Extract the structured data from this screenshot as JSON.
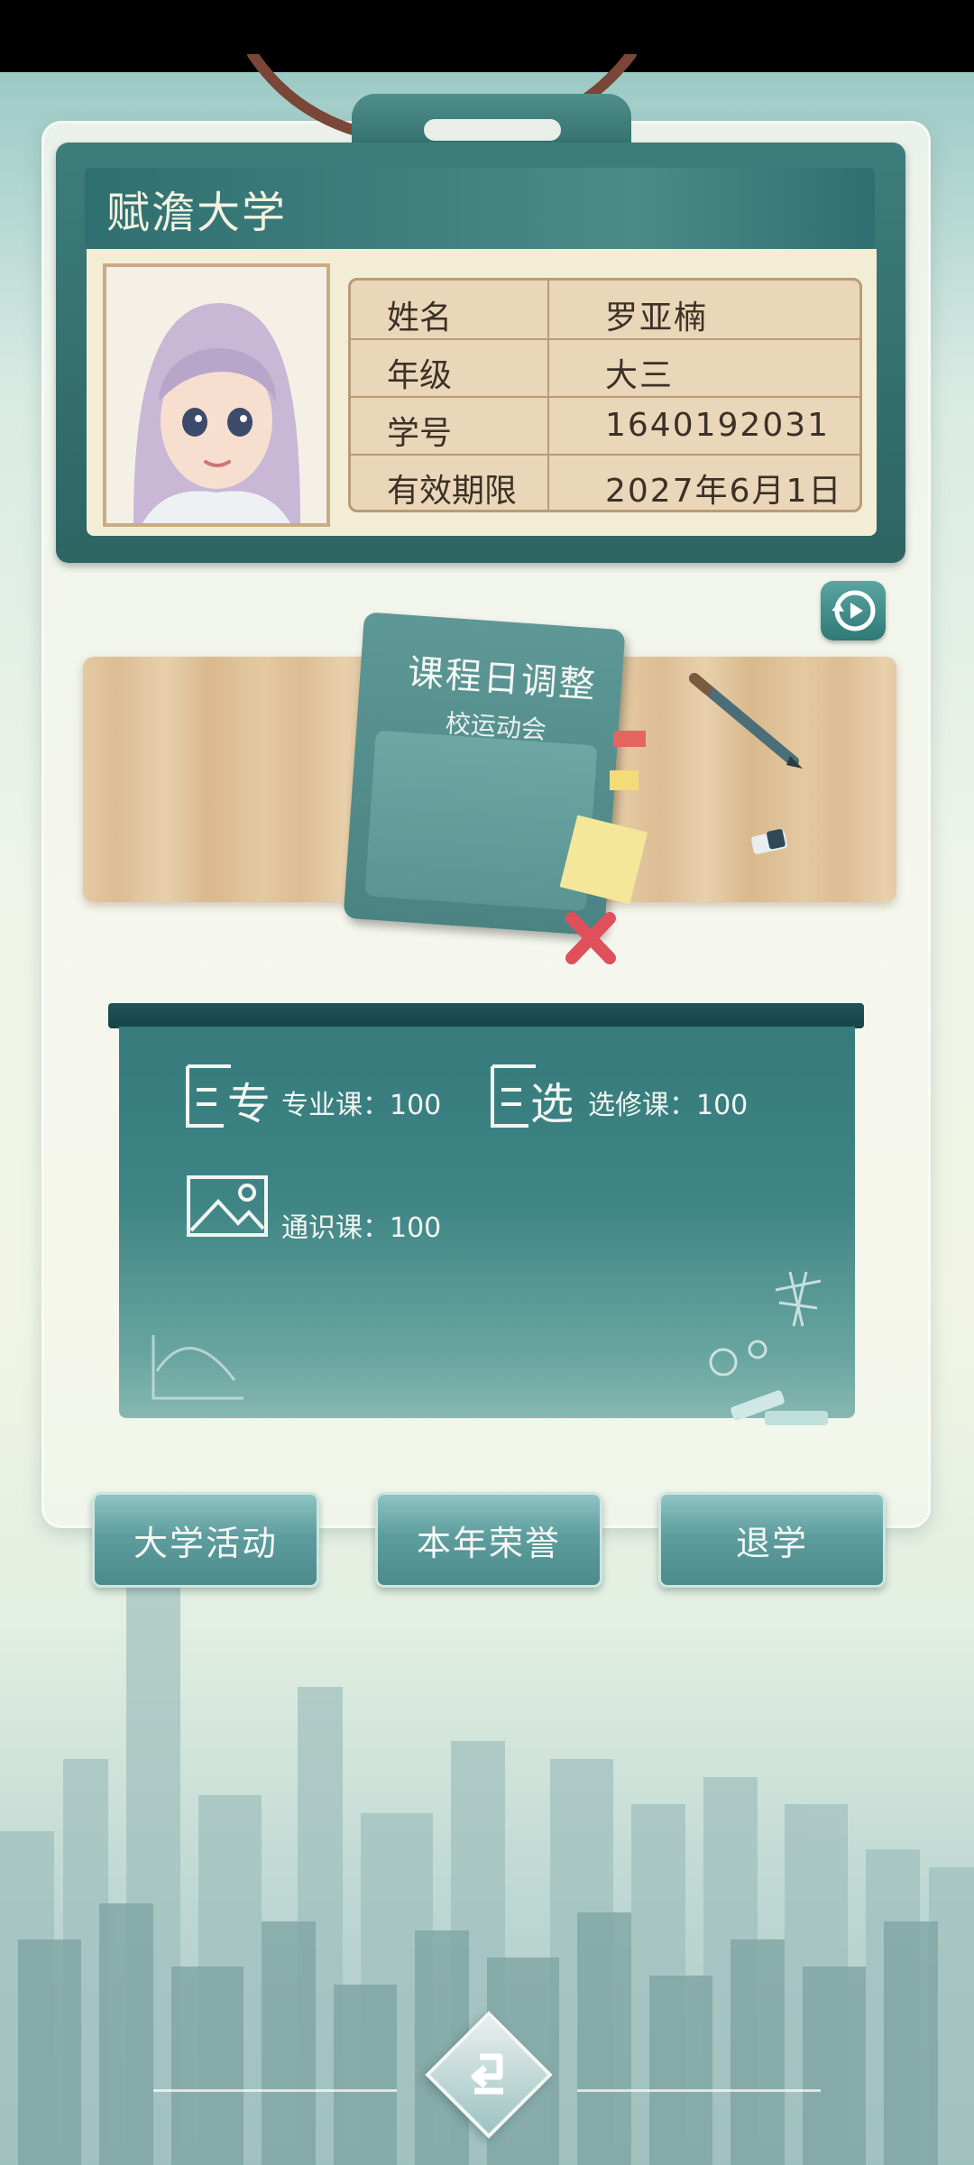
{
  "university": {
    "name": "赋澹大学"
  },
  "student": {
    "rows": [
      {
        "label": "姓名",
        "value": "罗亚楠"
      },
      {
        "label": "年级",
        "value": "大三"
      },
      {
        "label": "学号",
        "value": "1640192031"
      },
      {
        "label": "有效期限",
        "value": "2027年6月1日"
      }
    ]
  },
  "schedule": {
    "title": "课程日调整",
    "subtitle": "校运动会"
  },
  "courses": {
    "major": {
      "icon_text": "专",
      "label": "专业课：100"
    },
    "elective": {
      "icon_text": "选",
      "label": "选修课：100"
    },
    "general": {
      "label": "通识课：100"
    }
  },
  "buttons": {
    "activities": "大学活动",
    "honors": "本年荣誉",
    "dropout": "退学"
  },
  "icons": {
    "replay": "replay-icon",
    "back": "back-arrow-icon",
    "major": "major-course-icon",
    "elective": "elective-course-icon",
    "general": "general-course-icon"
  },
  "colors": {
    "primary_teal": "#2f6b69",
    "card_cream": "#f4edd6",
    "table_tan": "#ead6b8"
  }
}
